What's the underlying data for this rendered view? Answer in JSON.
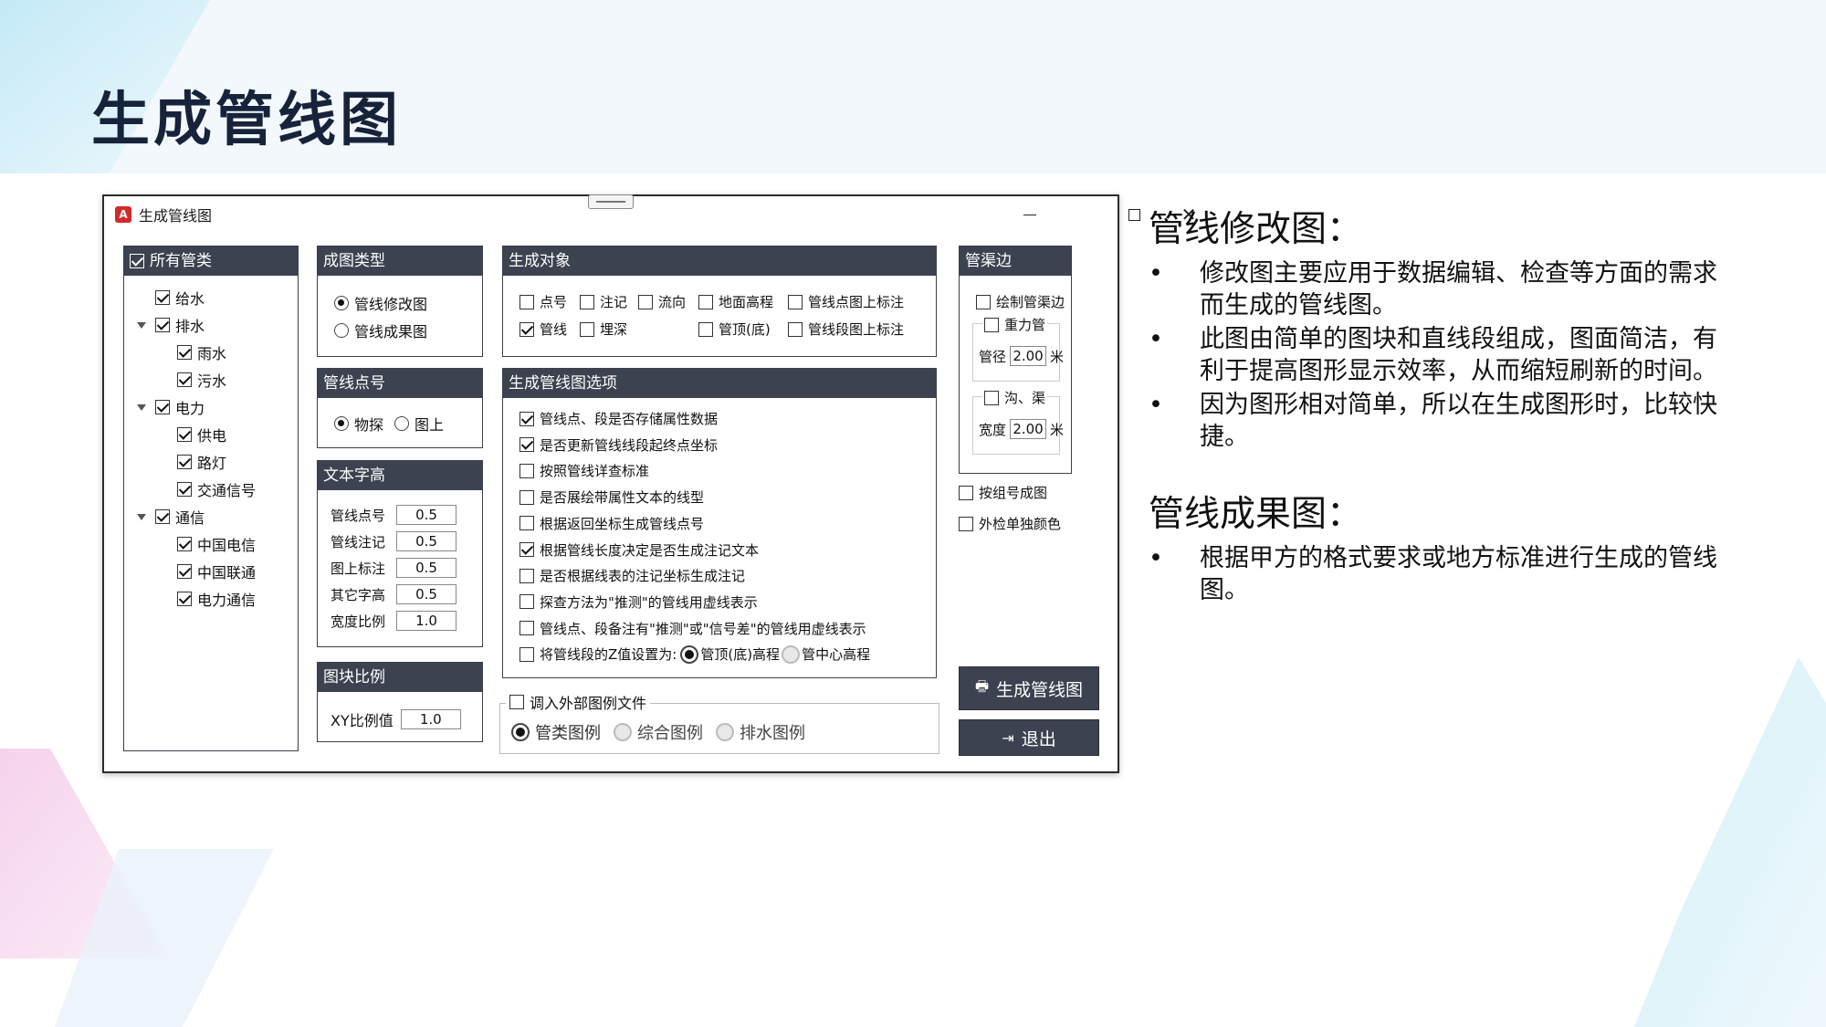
{
  "slide_title": "生成管线图",
  "window": {
    "title": "生成管线图",
    "app_icon": "A",
    "controls": {
      "minimize": "—",
      "maximize": "☐",
      "close": "✕"
    }
  },
  "pipe_types": {
    "header": "所有管类",
    "header_checked": true,
    "items": [
      {
        "label": "给水",
        "checked": true,
        "level": 0,
        "expandable": false
      },
      {
        "label": "排水",
        "checked": true,
        "level": 0,
        "expandable": true
      },
      {
        "label": "雨水",
        "checked": true,
        "level": 1
      },
      {
        "label": "污水",
        "checked": true,
        "level": 1
      },
      {
        "label": "电力",
        "checked": true,
        "level": 0,
        "expandable": true
      },
      {
        "label": "供电",
        "checked": true,
        "level": 1
      },
      {
        "label": "路灯",
        "checked": true,
        "level": 1
      },
      {
        "label": "交通信号",
        "checked": true,
        "level": 1
      },
      {
        "label": "通信",
        "checked": true,
        "level": 0,
        "expandable": true
      },
      {
        "label": "中国电信",
        "checked": true,
        "level": 1
      },
      {
        "label": "中国联通",
        "checked": true,
        "level": 1
      },
      {
        "label": "电力通信",
        "checked": true,
        "level": 1
      }
    ]
  },
  "drawing_type": {
    "header": "成图类型",
    "options": [
      "管线修改图",
      "管线成果图"
    ],
    "selected": 0
  },
  "point_no": {
    "header": "管线点号",
    "options": [
      "物探",
      "图上"
    ],
    "selected": 0
  },
  "text_height": {
    "header": "文本字高",
    "fields": [
      {
        "label": "管线点号",
        "value": "0.5"
      },
      {
        "label": "管线注记",
        "value": "0.5"
      },
      {
        "label": "图上标注",
        "value": "0.5"
      },
      {
        "label": "其它字高",
        "value": "0.5"
      },
      {
        "label": "宽度比例",
        "value": "1.0"
      }
    ]
  },
  "block_scale": {
    "header": "图块比例",
    "label": "XY比例值",
    "value": "1.0"
  },
  "gen_objects": {
    "header": "生成对象",
    "row1": [
      {
        "label": "点号",
        "checked": false
      },
      {
        "label": "注记",
        "checked": false
      },
      {
        "label": "流向",
        "checked": false
      },
      {
        "label": "地面高程",
        "checked": false
      },
      {
        "label": "管线点图上标注",
        "checked": false
      }
    ],
    "row2": [
      {
        "label": "管线",
        "checked": true
      },
      {
        "label": "埋深",
        "checked": false
      },
      {
        "label": "管顶(底)",
        "checked": false
      },
      {
        "label": "管线段图上标注",
        "checked": false
      }
    ]
  },
  "options": {
    "header": "生成管线图选项",
    "items": [
      {
        "label": "管线点、段是否存储属性数据",
        "checked": true
      },
      {
        "label": "是否更新管线线段起终点坐标",
        "checked": true
      },
      {
        "label": "按照管线详查标准",
        "checked": false
      },
      {
        "label": "是否展绘带属性文本的线型",
        "checked": false
      },
      {
        "label": "根据返回坐标生成管线点号",
        "checked": false
      },
      {
        "label": "根据管线长度决定是否生成注记文本",
        "checked": true
      },
      {
        "label": "是否根据线表的注记坐标生成注记",
        "checked": false
      },
      {
        "label": "探查方法为\"推测\"的管线用虚线表示",
        "checked": false
      },
      {
        "label": "管线点、段备注有\"推测\"或\"信号差\"的管线用虚线表示",
        "checked": false
      }
    ],
    "z_label": "将管线段的Z值设置为:",
    "z_options": [
      "管顶(底)高程",
      "管中心高程"
    ],
    "z_selected": 0
  },
  "legend": {
    "checkbox_label": "调入外部图例文件",
    "checked": false,
    "options": [
      "管类图例",
      "综合图例",
      "排水图例"
    ],
    "selected": 0
  },
  "channel_edge": {
    "header": "管渠边",
    "draw_label": "绘制管渠边",
    "draw_checked": false,
    "heavy_label": "重力管",
    "heavy_checked": false,
    "dia_label": "管径",
    "dia_value": "2.00",
    "dia_unit": "米",
    "ditch_label": "沟、渠",
    "ditch_checked": false,
    "width_label": "宽度",
    "width_value": "2.00",
    "width_unit": "米"
  },
  "extra": [
    {
      "label": "按组号成图",
      "checked": false
    },
    {
      "label": "外检单独颜色",
      "checked": false
    }
  ],
  "buttons": {
    "generate": "生成管线图",
    "exit": "退出"
  },
  "side": {
    "h1": "管线修改图：",
    "b1": [
      "修改图主要应用于数据编辑、检查等方面的需求而生成的管线图。",
      "此图由简单的图块和直线段组成，图面简洁，有利于提高图形显示效率，从而缩短刷新的时间。",
      "因为图形相对简单，所以在生成图形时，比较快捷。"
    ],
    "h2": "管线成果图：",
    "b2": [
      "根据甲方的格式要求或地方标准进行生成的管线图。"
    ]
  }
}
